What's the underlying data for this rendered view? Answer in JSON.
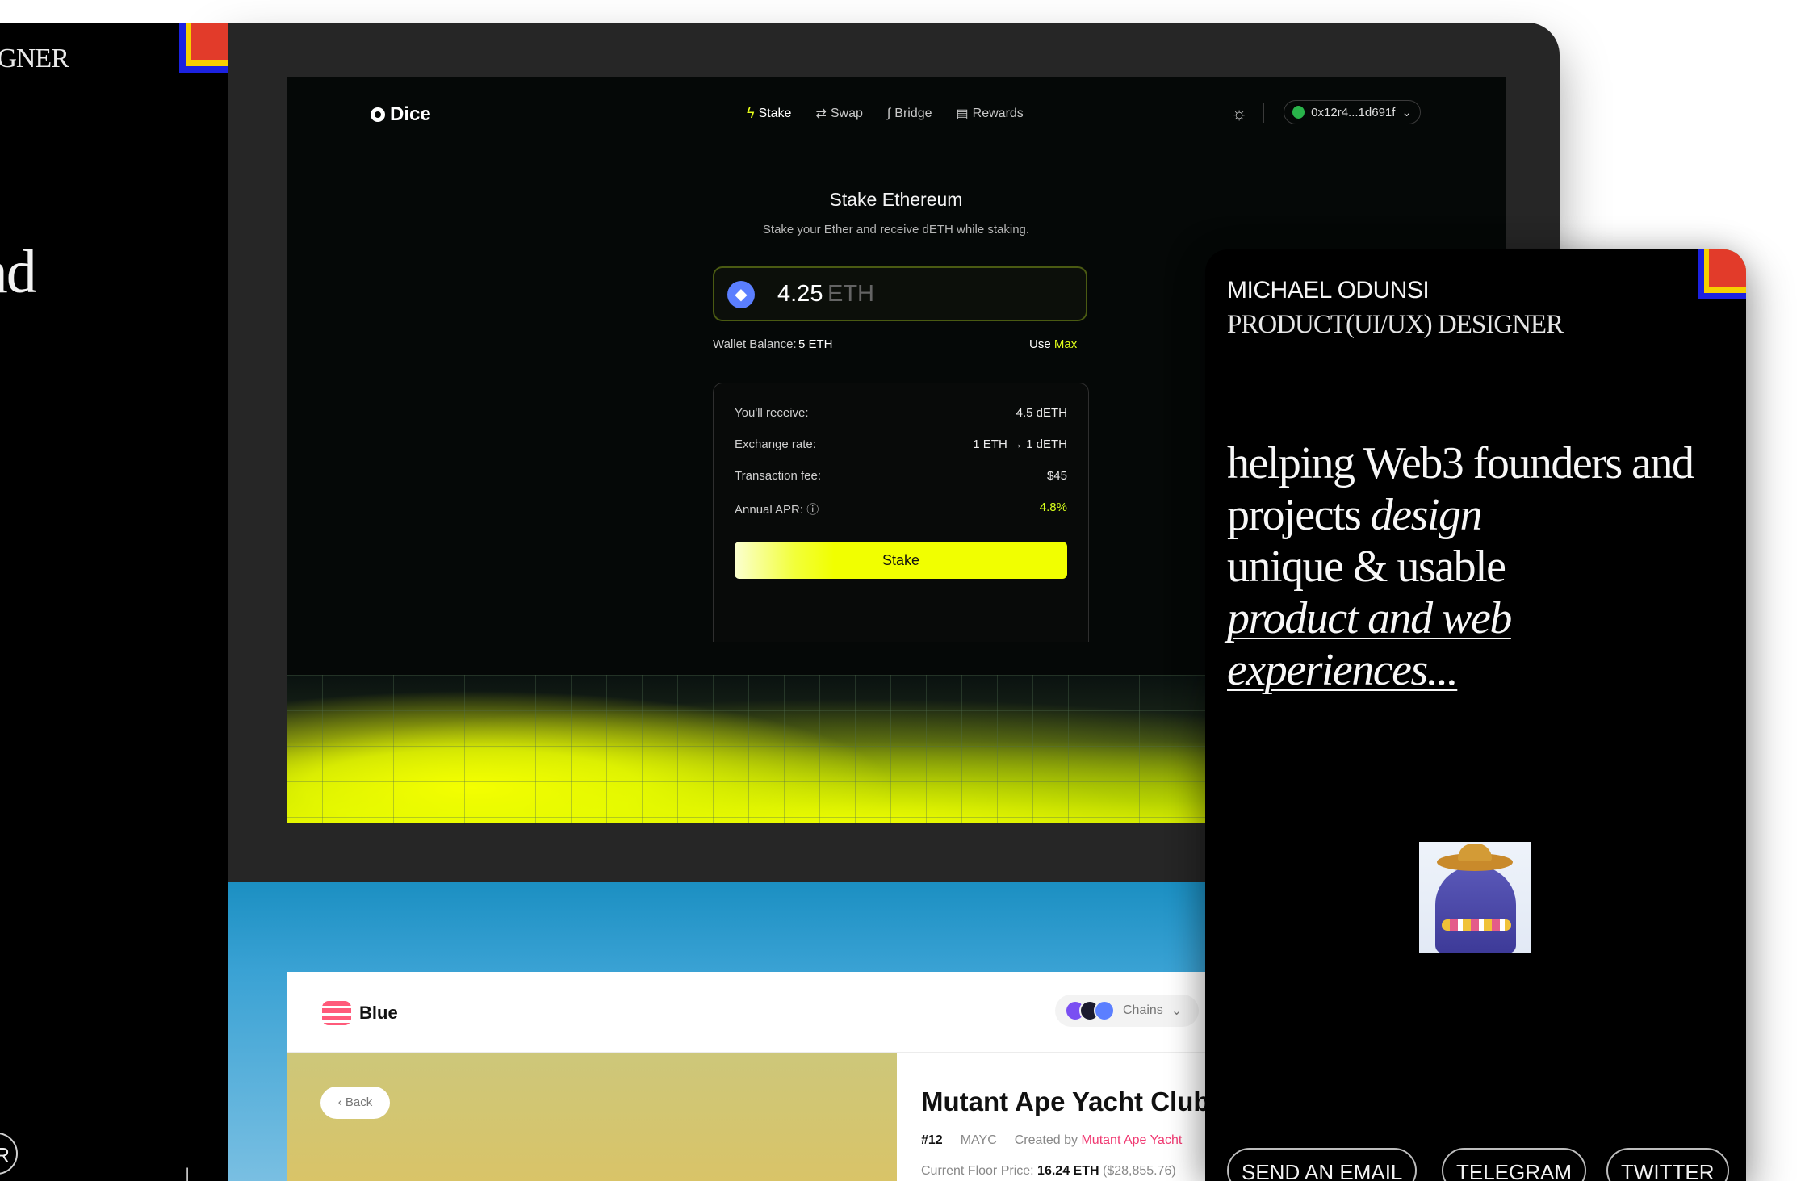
{
  "left_panel": {
    "role_fragment": "IGNER",
    "hero_fragment": "and\n&\n?",
    "button_fragment": "R"
  },
  "dice": {
    "brand": "Dice",
    "nav": [
      {
        "label": "Stake",
        "icon": "bolt-icon",
        "active": true
      },
      {
        "label": "Swap",
        "icon": "swap-icon",
        "active": false
      },
      {
        "label": "Bridge",
        "icon": "bridge-icon",
        "active": false
      },
      {
        "label": "Rewards",
        "icon": "rewards-icon",
        "active": false
      }
    ],
    "wallet_address": "0x12r4...1d691f",
    "title": "Stake Ethereum",
    "subtitle": "Stake your Ether and receive dETH while staking.",
    "amount": "4.25",
    "amount_unit": "ETH",
    "balance_label": "Wallet Balance:",
    "balance_value": "5 ETH",
    "use_label": "Use",
    "max_label": "Max",
    "summary": [
      {
        "label": "You'll receive:",
        "value": "4.5 dETH"
      },
      {
        "label": "Exchange rate:",
        "value": "1 ETH → 1 dETH"
      },
      {
        "label": "Transaction fee:",
        "value": "$45"
      },
      {
        "label": "Annual APR: ⓘ",
        "value": "4.8%"
      }
    ],
    "stake_button": "Stake",
    "accent_color": "#f1ff00"
  },
  "blue": {
    "brand": "Blue",
    "chains_label": "Chains",
    "back_label": "Back",
    "nft_title": "Mutant Ape Yacht Club",
    "nft_id": "#12",
    "nft_symbol": "MAYC",
    "created_by_label": "Created by",
    "creator": "Mutant Ape Yacht",
    "floor_label": "Current Floor Price:",
    "floor_value": "16.24 ETH",
    "floor_usd": "($28,855.76)",
    "accent_color": "#f03a72"
  },
  "phone": {
    "name": "MICHAEL ODUNSI",
    "role": "PRODUCT(UI/UX) DESIGNER",
    "hero_plain_1": "helping Web3 founders and projects",
    "hero_italic": "design",
    "hero_plain_2": "unique & usable",
    "hero_underlined": "product and web experiences...",
    "buttons": [
      "SEND AN EMAIL",
      "TELEGRAM",
      "TWITTER"
    ]
  },
  "colors": {
    "badge_blue": "#1c22e0",
    "badge_yellow": "#f6d000",
    "badge_red": "#e23b2a"
  }
}
